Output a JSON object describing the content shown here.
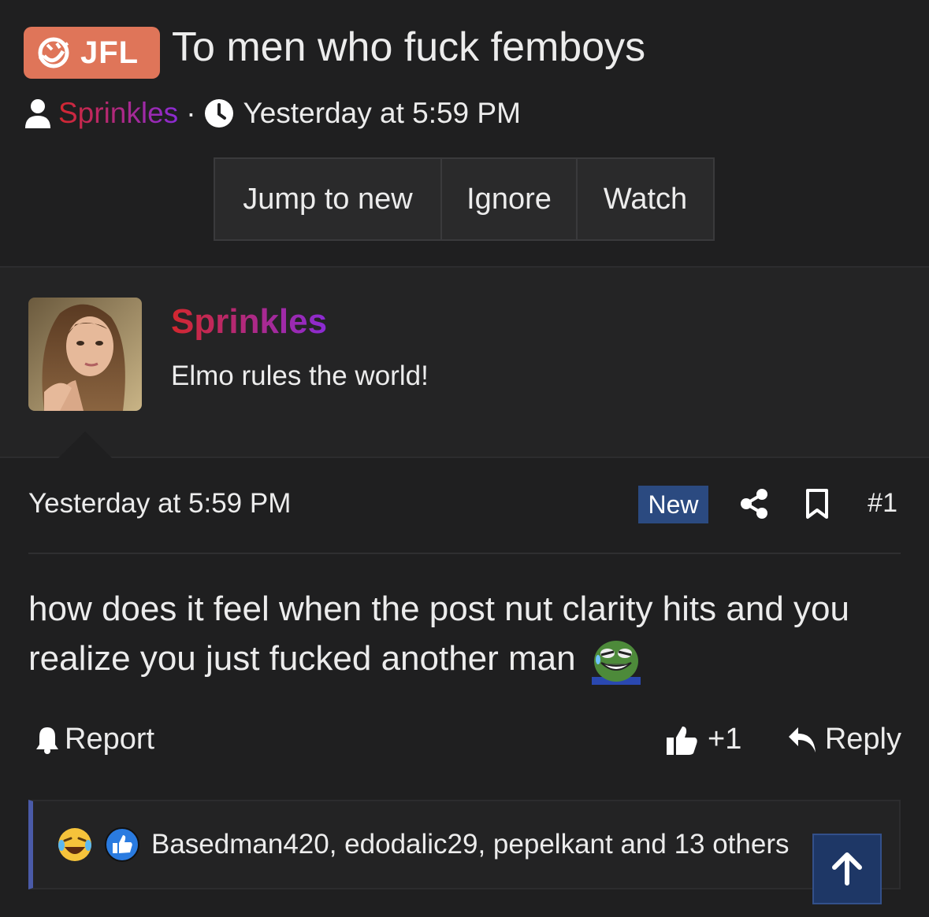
{
  "thread": {
    "prefix_label": "JFL",
    "prefix_icon": "rolling-laugh-icon",
    "prefix_color": "#df7559",
    "title": "To men who fuck femboys",
    "author": "Sprinkles",
    "separator": "·",
    "timestamp": "Yesterday at 5:59 PM"
  },
  "thread_actions": {
    "jump_label": "Jump to new",
    "ignore_label": "Ignore",
    "watch_label": "Watch"
  },
  "post": {
    "author_name": "Sprinkles",
    "author_title": "Elmo rules the world!",
    "timestamp": "Yesterday at 5:59 PM",
    "new_badge": "New",
    "post_number": "#1",
    "body": "how does it feel when the post nut clarity hits and you realize you just fucked another man",
    "emoji": "pepe-laugh-cry-icon",
    "report_label": "Report",
    "like_count": "+1",
    "reply_label": "Reply",
    "reactions_text": "Basedman420, edodalic29, pepelkant and 13 others",
    "reaction_icons": [
      "laugh-cry-emoji-icon",
      "thumbs-up-emoji-icon"
    ]
  },
  "colors": {
    "background": "#1f1f20",
    "username_gradient_start": "#d3272d",
    "username_gradient_end": "#8b2bd6",
    "new_badge_bg": "#2b4a80",
    "reaction_border": "#4a5aa8",
    "scroll_top_bg": "#1e3766"
  }
}
